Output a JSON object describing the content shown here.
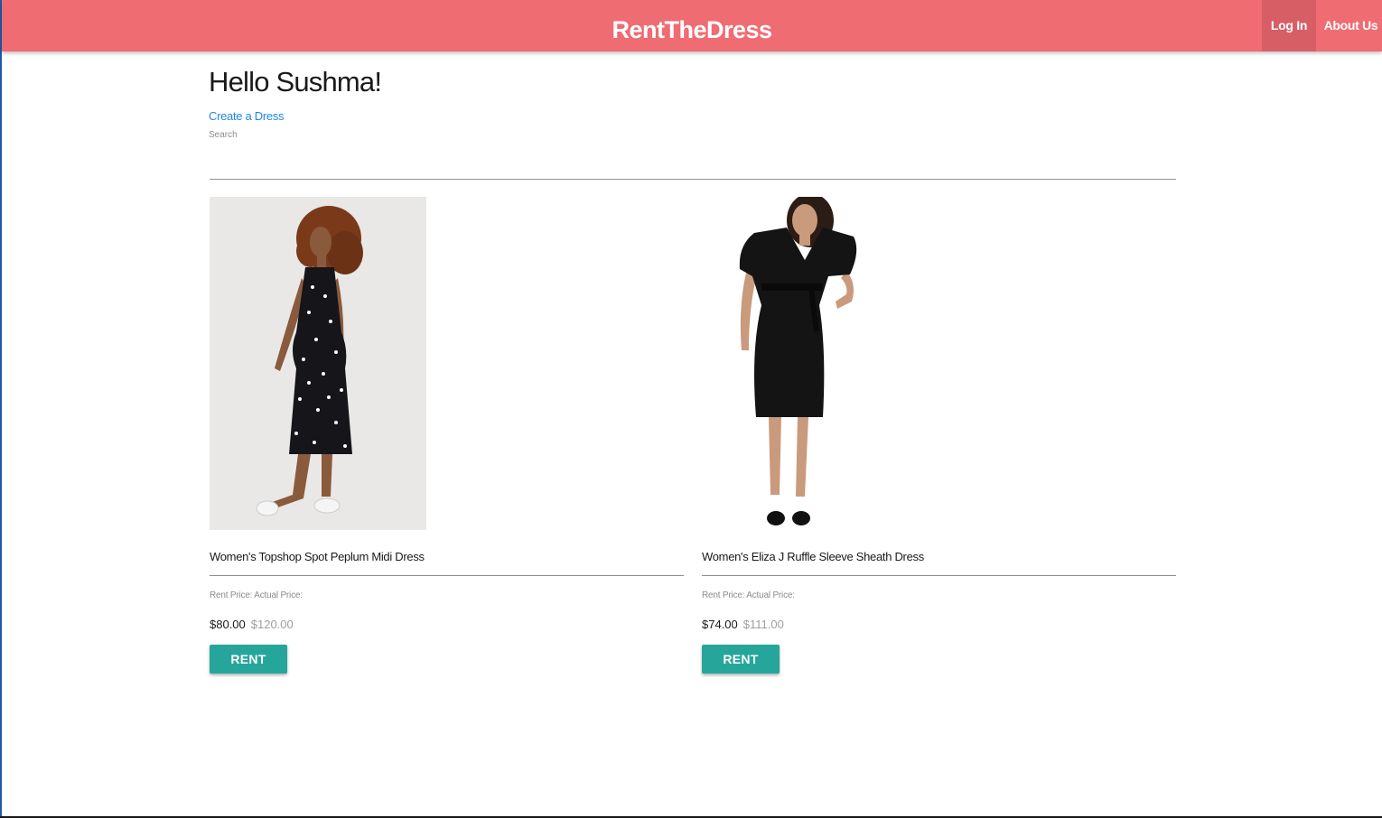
{
  "header": {
    "brand": "RentTheDress",
    "login_label": "Log In",
    "about_label": "About Us",
    "bg_color": "#ef6c72"
  },
  "main": {
    "greeting": "Hello Sushma!",
    "create_link": "Create a Dress",
    "search_label": "Search",
    "search_value": ""
  },
  "dresses": [
    {
      "name": "Women's Topshop Spot Peplum Midi Dress",
      "price_labels": "Rent Price: Actual Price:",
      "rent_price": "$80.00",
      "actual_price": "$120.00",
      "button": "RENT"
    },
    {
      "name": "Women's Eliza J Ruffle Sleeve Sheath Dress",
      "price_labels": "Rent Price: Actual Price:",
      "rent_price": "$74.00",
      "actual_price": "$111.00",
      "button": "RENT"
    }
  ],
  "colors": {
    "accent_button": "#26a69a",
    "link": "#1e88e5"
  }
}
